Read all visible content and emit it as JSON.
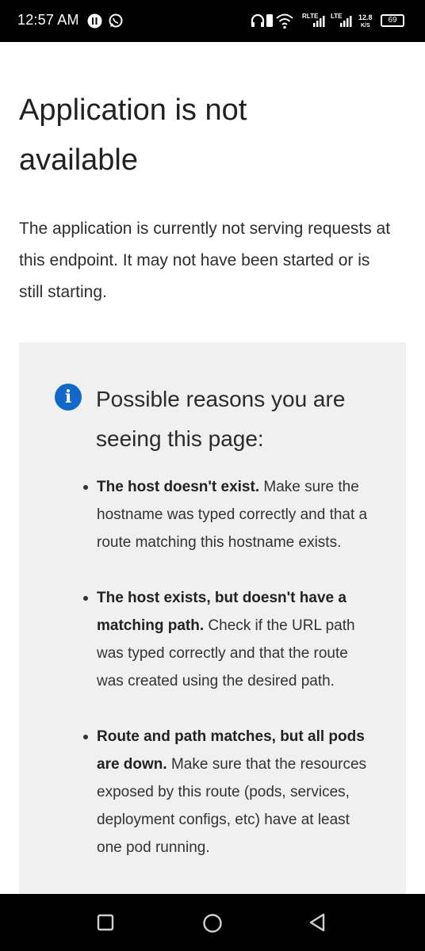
{
  "status_bar": {
    "time": "12:57 AM",
    "network_label_1": "RLTE",
    "network_label_2": "LTE",
    "speed_value": "12.8",
    "speed_unit": "K/S",
    "battery": "69"
  },
  "page": {
    "title": "Application is not available",
    "intro": "The application is currently not serving requests at this endpoint. It may not have been started or is still starting."
  },
  "panel": {
    "icon": "info-icon",
    "title": "Possible reasons you are seeing this page:",
    "reasons": [
      {
        "bold": "The host doesn't exist.",
        "text": " Make sure the hostname was typed correctly and that a route matching this hostname exists."
      },
      {
        "bold": "The host exists, but doesn't have a matching path.",
        "text": " Check if the URL path was typed correctly and that the route was created using the desired path."
      },
      {
        "bold": "Route and path matches, but all pods are down.",
        "text": " Make sure that the resources exposed by this route (pods, services, deployment configs, etc) have at least one pod running."
      }
    ]
  },
  "nav_bar": {
    "recents_icon": "square-icon",
    "home_icon": "circle-icon",
    "back_icon": "triangle-back-icon"
  }
}
